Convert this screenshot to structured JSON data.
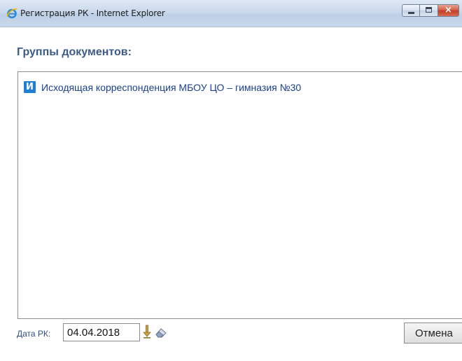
{
  "window": {
    "title": "Регистрация РК - Internet Explorer",
    "app_icon": "internet-explorer-icon",
    "controls": [
      "minimize-icon",
      "maximize-icon",
      "close-icon"
    ]
  },
  "section": {
    "heading": "Группы документов:"
  },
  "doc_groups": [
    {
      "badge": "И",
      "label": "Исходящая корреспонденция МБОУ ЦО – гимназия №30",
      "badge_color": "#1f7fd4"
    }
  ],
  "footer": {
    "date_label": "Дата РК:",
    "date_value": "04.04.2018",
    "icons": [
      "down-arrow-icon",
      "eraser-icon"
    ],
    "cancel_label": "Отмена"
  },
  "colors": {
    "heading": "#3b5b8a",
    "link": "#1a3f8f",
    "titlebar": "#cad9ec"
  }
}
